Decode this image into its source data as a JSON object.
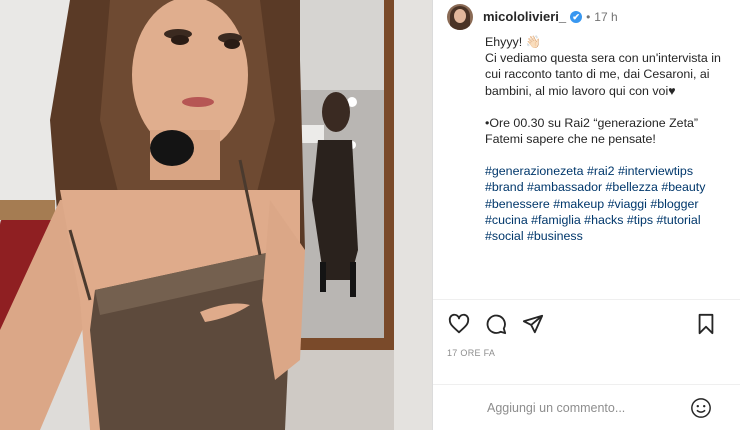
{
  "post": {
    "username": "micololivieri_",
    "verified_mark": "✔",
    "separator": "•",
    "time": "17 h",
    "caption": {
      "line1": "Ehyyy! 👋🏻",
      "line2": "Ci vediamo questa sera con un'intervista in cui racconto tanto di me, dai Cesaroni, ai bambini, al mio lavoro qui con voi♥",
      "line3": "•Ore 00.30 su Rai2 “generazione Zeta”",
      "line4": "Fatemi sapere che ne pensate!",
      "hashtags": "#generazionezeta #rai2 #interviewtips #brand #ambassador #bellezza #beauty #benessere #makeup #viaggi #blogger #cucina #famiglia #hacks #tips #tutorial #social #business"
    },
    "date": "17 ORE FA",
    "comment": {
      "placeholder": "Aggiungi un commento..."
    },
    "icons": {
      "like": "heart-icon",
      "comment": "speech-bubble-icon",
      "share": "paper-plane-icon",
      "save": "bookmark-icon",
      "emoji": "smiley-icon"
    }
  }
}
